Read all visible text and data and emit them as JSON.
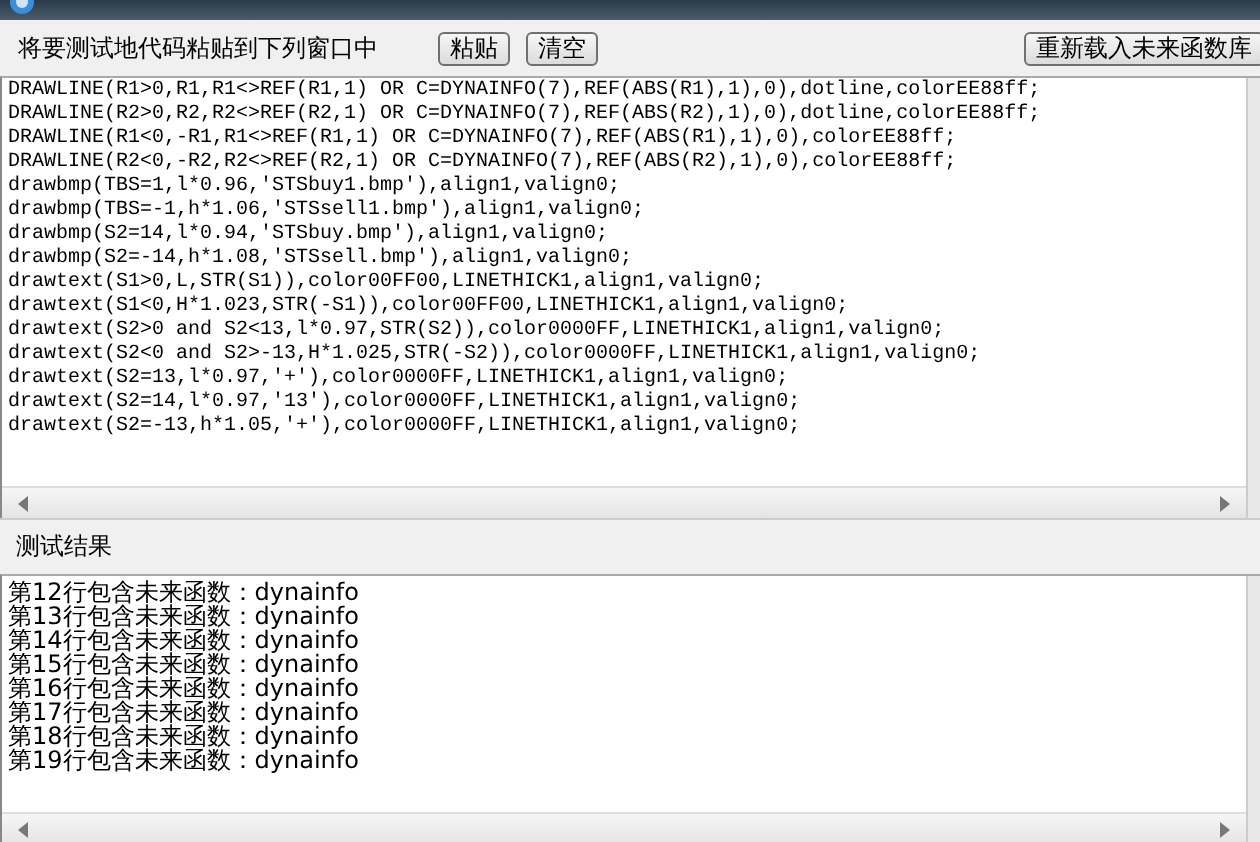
{
  "toolbar": {
    "prompt": "将要测试地代码粘贴到下列窗口中",
    "buttons": [
      "粘贴",
      "清空"
    ],
    "reload_button": "重新载入未来函数库"
  },
  "code_lines": [
    "DRAWLINE(R1>0,R1,R1<>REF(R1,1) OR C=DYNAINFO(7),REF(ABS(R1),1),0),dotline,colorEE88ff;",
    "DRAWLINE(R2>0,R2,R2<>REF(R2,1) OR C=DYNAINFO(7),REF(ABS(R2),1),0),dotline,colorEE88ff;",
    "DRAWLINE(R1<0,-R1,R1<>REF(R1,1) OR C=DYNAINFO(7),REF(ABS(R1),1),0),colorEE88ff;",
    "DRAWLINE(R2<0,-R2,R2<>REF(R2,1) OR C=DYNAINFO(7),REF(ABS(R2),1),0),colorEE88ff;",
    "drawbmp(TBS=1,l*0.96,'STSbuy1.bmp'),align1,valign0;",
    "drawbmp(TBS=-1,h*1.06,'STSsell1.bmp'),align1,valign0;",
    "drawbmp(S2=14,l*0.94,'STSbuy.bmp'),align1,valign0;",
    "drawbmp(S2=-14,h*1.08,'STSsell.bmp'),align1,valign0;",
    "drawtext(S1>0,L,STR(S1)),color00FF00,LINETHICK1,align1,valign0;",
    "drawtext(S1<0,H*1.023,STR(-S1)),color00FF00,LINETHICK1,align1,valign0;",
    "drawtext(S2>0 and S2<13,l*0.97,STR(S2)),color0000FF,LINETHICK1,align1,valign0;",
    "drawtext(S2<0 and S2>-13,H*1.025,STR(-S2)),color0000FF,LINETHICK1,align1,valign0;",
    "drawtext(S2=13,l*0.97,'+'),color0000FF,LINETHICK1,align1,valign0;",
    "drawtext(S2=14,l*0.97,'13'),color0000FF,LINETHICK1,align1,valign0;",
    "drawtext(S2=-13,h*1.05,'+'),color0000FF,LINETHICK1,align1,valign0;"
  ],
  "results_label": "测试结果",
  "results": [
    "第12行包含未来函数：dynainfo",
    "第13行包含未来函数：dynainfo",
    "第14行包含未来函数：dynainfo",
    "第15行包含未来函数：dynainfo",
    "第16行包含未来函数：dynainfo",
    "第17行包含未来函数：dynainfo",
    "第18行包含未来函数：dynainfo",
    "第19行包含未来函数：dynainfo"
  ]
}
